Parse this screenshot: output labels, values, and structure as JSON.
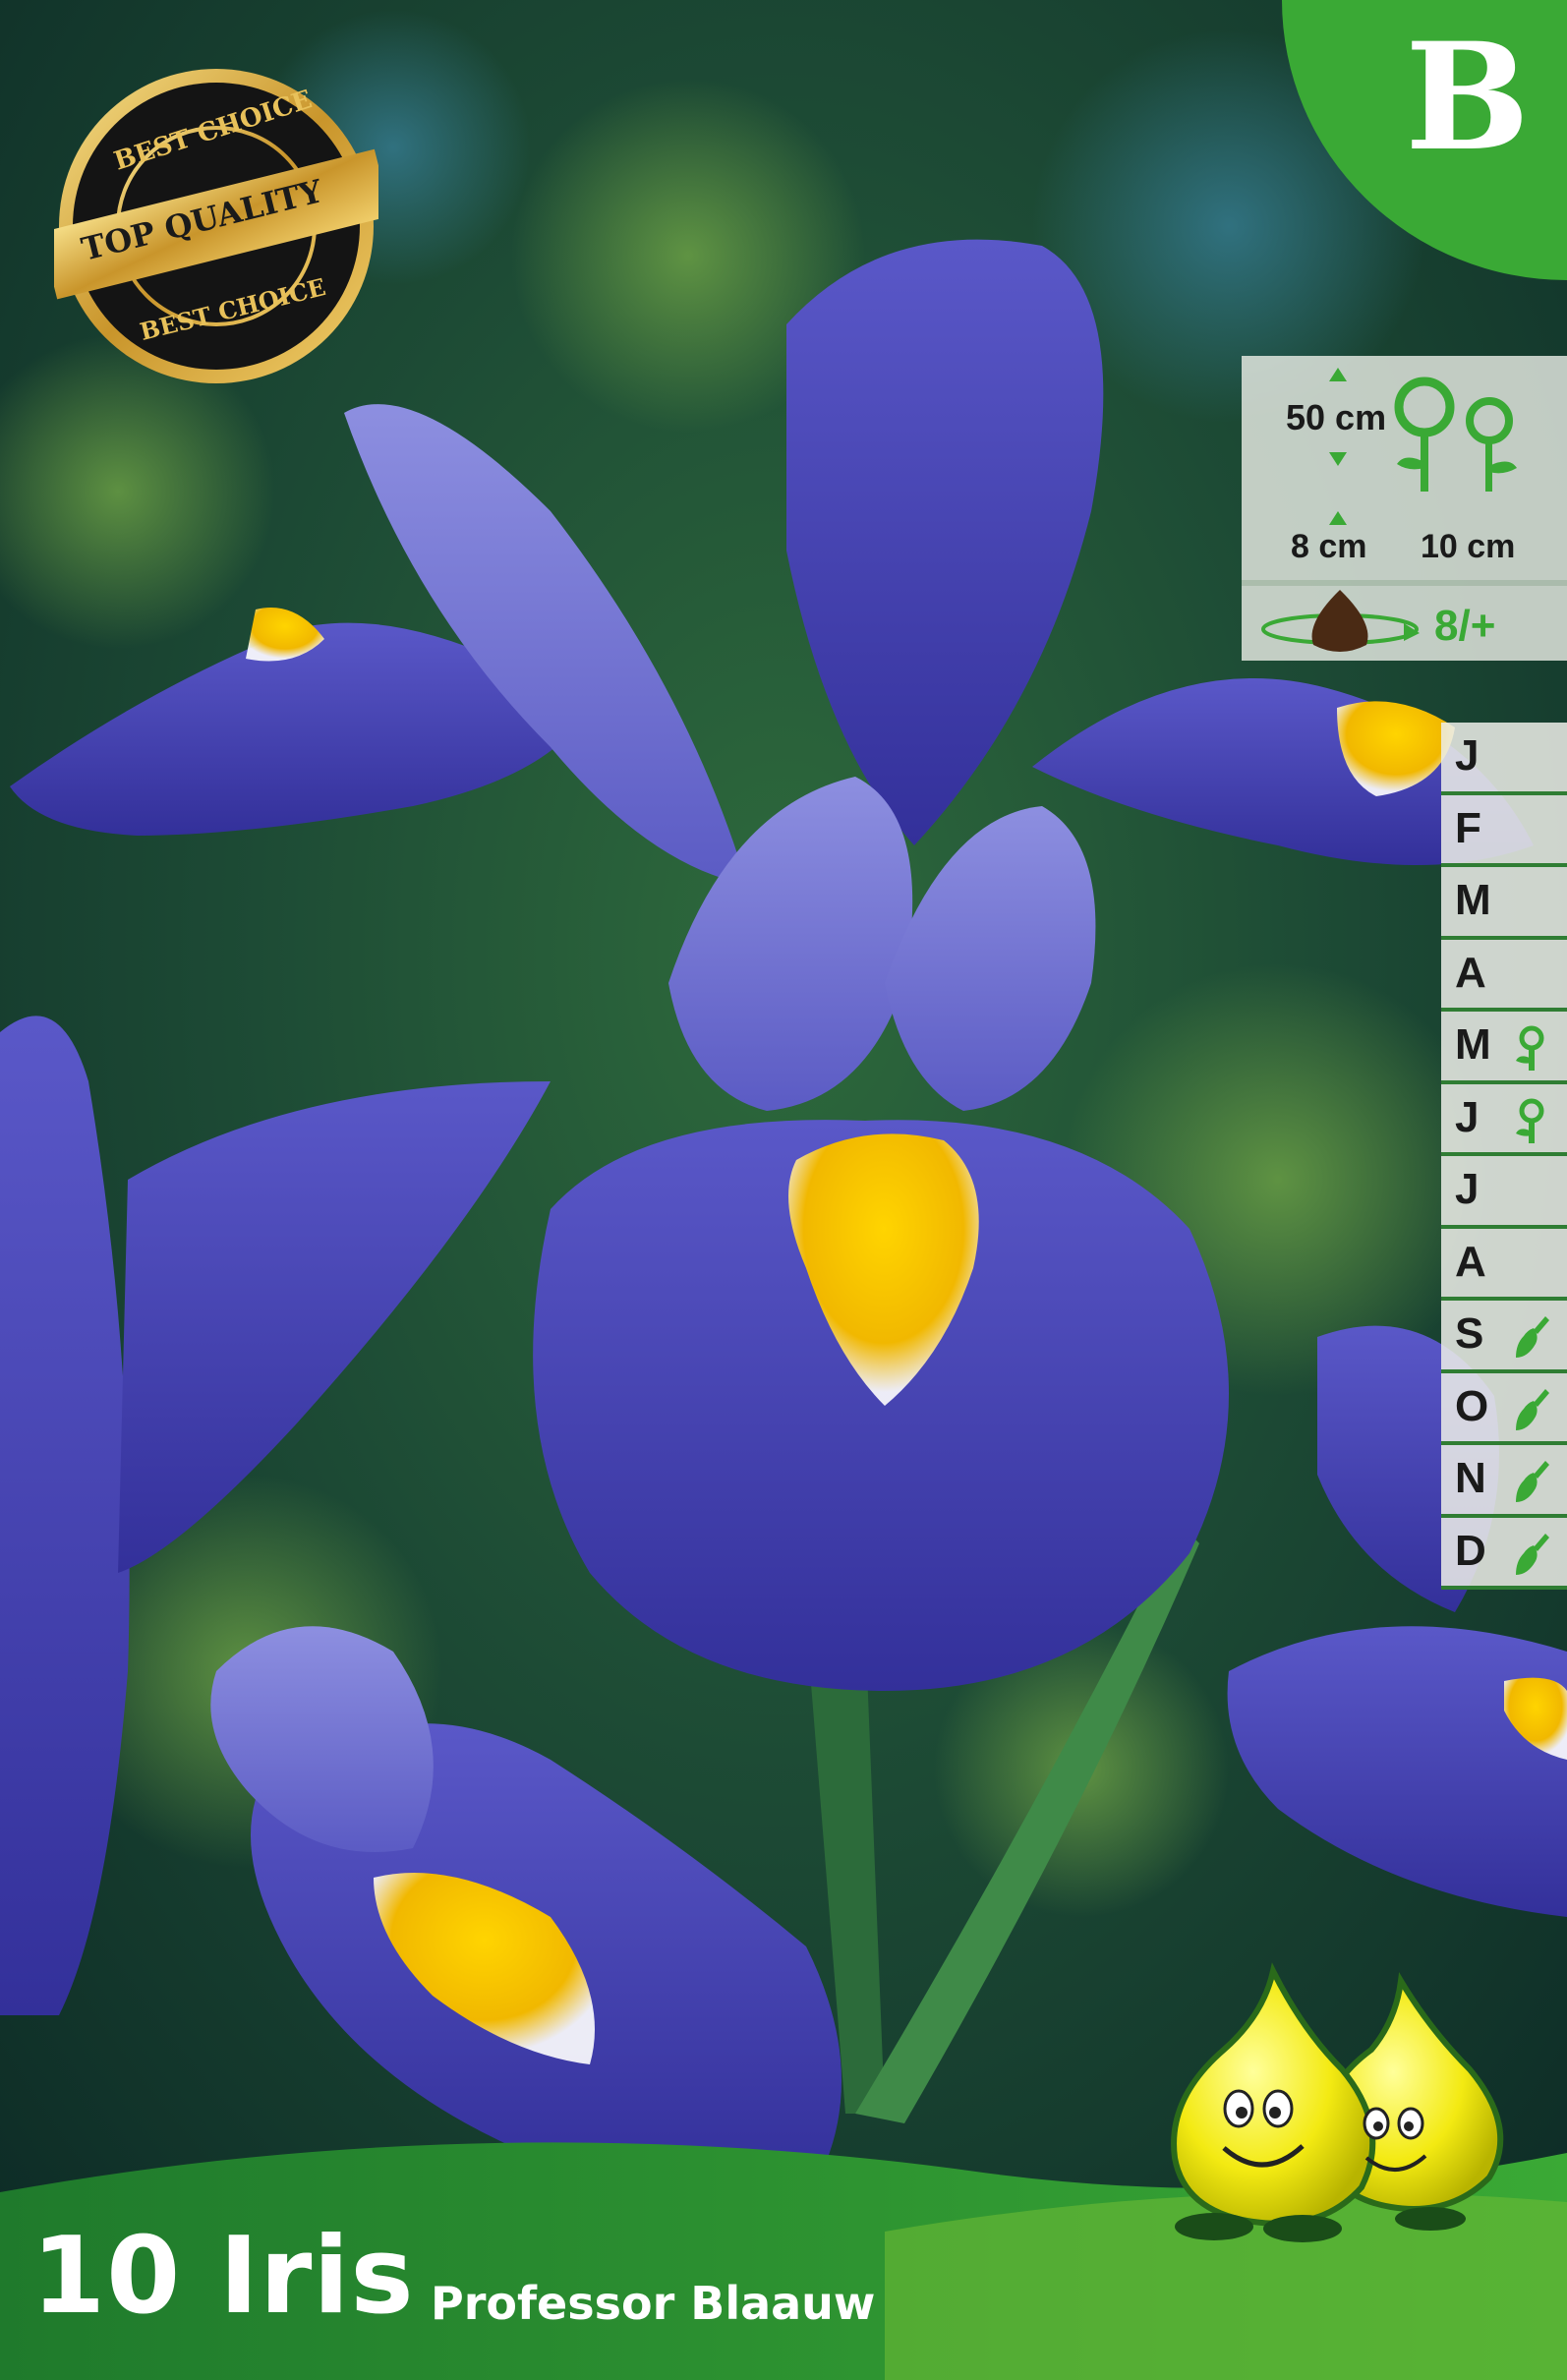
{
  "badge": {
    "letter": "B"
  },
  "seal": {
    "top_text": "BEST CHOICE",
    "center_text": "TOP QUALITY",
    "bottom_text": "BEST CHOICE"
  },
  "planting_info": {
    "height": "50 cm",
    "depth": "8 cm",
    "spacing": "10 cm",
    "bulb_count_hint": "8/+"
  },
  "calendar": {
    "months": [
      {
        "letter": "J",
        "icon": ""
      },
      {
        "letter": "F",
        "icon": ""
      },
      {
        "letter": "M",
        "icon": ""
      },
      {
        "letter": "A",
        "icon": ""
      },
      {
        "letter": "M",
        "icon": "flower-icon"
      },
      {
        "letter": "J",
        "icon": "flower-icon"
      },
      {
        "letter": "J",
        "icon": ""
      },
      {
        "letter": "A",
        "icon": ""
      },
      {
        "letter": "S",
        "icon": "trowel-icon"
      },
      {
        "letter": "O",
        "icon": "trowel-icon"
      },
      {
        "letter": "N",
        "icon": "trowel-icon"
      },
      {
        "letter": "D",
        "icon": "trowel-icon"
      }
    ]
  },
  "product": {
    "title": "10 Iris",
    "variety": "Professor Blaauw"
  },
  "colors": {
    "brand_green": "#3aa935",
    "iris_blue": "#3b3fa8",
    "falls_yellow": "#f5c400"
  }
}
